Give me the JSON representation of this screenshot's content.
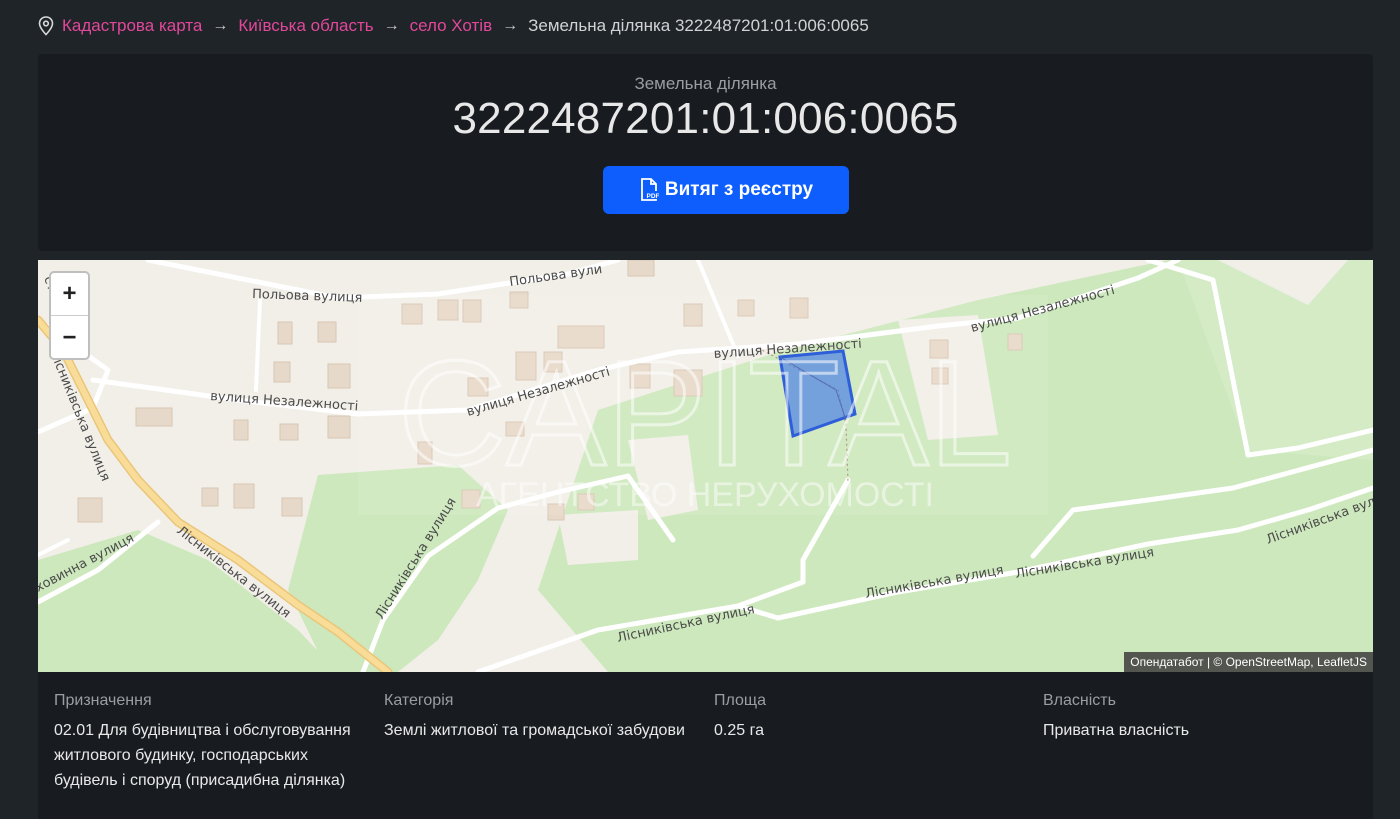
{
  "breadcrumb": {
    "items": [
      "Кадастрова карта",
      "Київська область",
      "село Хотів"
    ],
    "current": "Земельна ділянка 3222487201:01:006:0065"
  },
  "header": {
    "subtitle": "Земельна ділянка",
    "title": "3222487201:01:006:0065",
    "button_label": "Витяг з реєстру"
  },
  "map": {
    "streets": [
      "Польова вулиця",
      "Польова вули",
      "вулиця Незалежності",
      "вулиця Незалежності",
      "вулиця Незалежності",
      "вулиця Незалежності",
      "Лісниківська вулиця",
      "Лісниківська вулиця",
      "Лісниківська вулиця",
      "Лісниківська вулиця",
      "Лісниківська вулиця",
      "Лісниківська вулиця",
      "Лісниківська вулиця",
      "ховинна вулиця",
      "сті"
    ],
    "watermark": "CAPITAL",
    "watermark_sub": "АГЕНТСТВО НЕРУХОМОСТІ",
    "zoom_in": "+",
    "zoom_out": "−",
    "attribution": "Опендатабот | © OpenStreetMap, LeafletJS",
    "colors": {
      "parcel": "#2f6fe8",
      "green": "#cde8bd",
      "road": "#ffffff",
      "main_road": "#f5d58a"
    }
  },
  "details": [
    {
      "label": "Призначення",
      "value": "02.01 Для будівництва і обслуговування житлового будинку, господарських будівель і споруд (присадибна ділянка)"
    },
    {
      "label": "Категорія",
      "value": "Землі житлової та громадської забудови"
    },
    {
      "label": "Площа",
      "value": "0.25 га"
    },
    {
      "label": "Власність",
      "value": "Приватна власність"
    }
  ]
}
